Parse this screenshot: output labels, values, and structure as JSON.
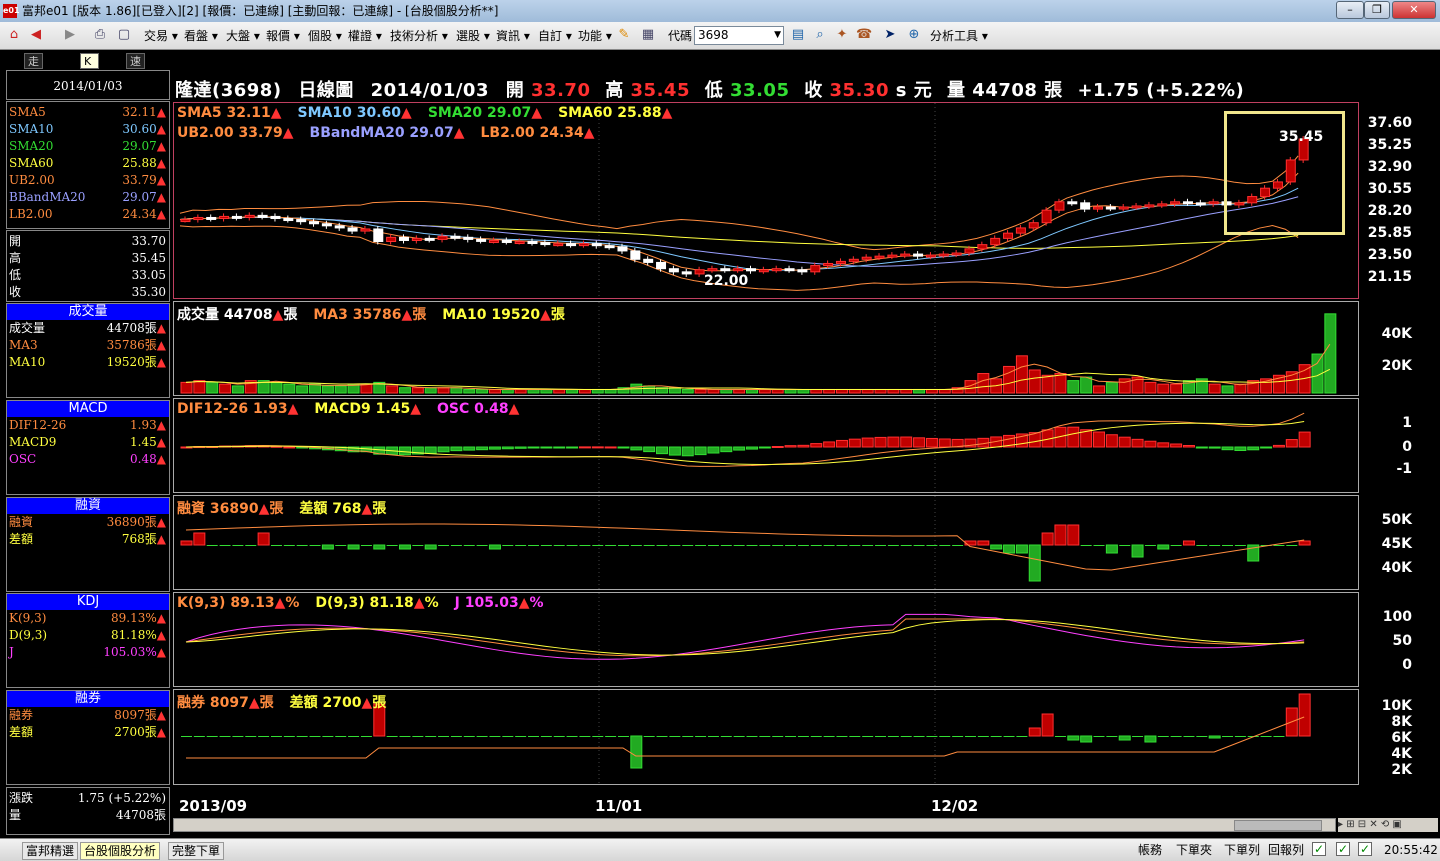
{
  "window": {
    "title": "富邦e01 [版本 1.86][已登入][2] [報價：已連線] [主動回報：已連線] - [台股個股分析**]",
    "app_icon": "e01",
    "min_btn": "–",
    "max_btn": "❐",
    "close_btn": "✕"
  },
  "toolbar": {
    "menus": [
      "交易",
      "看盤",
      "大盤",
      "報價",
      "個股",
      "權證",
      "技術分析",
      "選股",
      "資訊",
      "自訂",
      "功能"
    ],
    "code_label": "代碼",
    "code_value": "3698",
    "analysis_tools": "分析工具"
  },
  "tabs": [
    "走勢圖",
    "K線圖",
    "速覽"
  ],
  "left": {
    "date": "2014/01/03",
    "ma": [
      {
        "k": "SMA5",
        "v": "32.11",
        "c": "#ff8c40"
      },
      {
        "k": "SMA10",
        "v": "30.60",
        "c": "#7ec8ff"
      },
      {
        "k": "SMA20",
        "v": "29.07",
        "c": "#33dd33"
      },
      {
        "k": "SMA60",
        "v": "25.88",
        "c": "#ffff40"
      },
      {
        "k": "UB2.00",
        "v": "33.79",
        "c": "#ff8c40"
      },
      {
        "k": "BBandMA20",
        "v": "29.07",
        "c": "#9aa0ff"
      },
      {
        "k": "LB2.00",
        "v": "24.34",
        "c": "#ff8c40"
      }
    ],
    "ohlc": [
      {
        "k": "開",
        "v": "33.70"
      },
      {
        "k": "高",
        "v": "35.45"
      },
      {
        "k": "低",
        "v": "33.05"
      },
      {
        "k": "收",
        "v": "35.30"
      }
    ],
    "vol_head": "成交量",
    "vol": [
      {
        "k": "成交量",
        "v": "44708張",
        "c": "#ffffff"
      },
      {
        "k": "MA3",
        "v": "35786張",
        "c": "#ff8c40"
      },
      {
        "k": "MA10",
        "v": "19520張",
        "c": "#ffff40"
      }
    ],
    "macd_head": "MACD",
    "macd": [
      {
        "k": "DIF12-26",
        "v": "1.93",
        "c": "#ff8c40"
      },
      {
        "k": "MACD9",
        "v": "1.45",
        "c": "#ffff40"
      },
      {
        "k": "OSC",
        "v": "0.48",
        "c": "#ff40ff"
      }
    ],
    "margin_head": "融資",
    "margin": [
      {
        "k": "融資",
        "v": "36890張",
        "c": "#ff8c40"
      },
      {
        "k": "差額",
        "v": "768張",
        "c": "#ffff40"
      }
    ],
    "kdj_head": "KDJ",
    "kdj": [
      {
        "k": "K(9,3)",
        "v": "89.13%",
        "c": "#ff8c40"
      },
      {
        "k": "D(9,3)",
        "v": "81.18%",
        "c": "#ffff40"
      },
      {
        "k": "J",
        "v": "105.03%",
        "c": "#ff40ff"
      }
    ],
    "short_head": "融券",
    "short": [
      {
        "k": "融券",
        "v": "8097張",
        "c": "#ff8c40"
      },
      {
        "k": "差額",
        "v": "2700張",
        "c": "#ffff40"
      }
    ],
    "change": {
      "k": "漲跌",
      "v": "1.75 (+5.22%)"
    },
    "volume": {
      "k": "量",
      "v": "44708張"
    }
  },
  "header": {
    "name": "隆達(3698)",
    "type": "日線圖",
    "date": "2014/01/03",
    "open_lbl": "開",
    "open": "33.70",
    "high_lbl": "高",
    "high": "35.45",
    "low_lbl": "低",
    "low": "33.05",
    "close_lbl": "收",
    "close": "35.30",
    "unit": "s 元",
    "vol_lbl": "量",
    "vol": "44708 張",
    "chg": "+1.75 (+5.22%)"
  },
  "legends": {
    "price1": [
      {
        "t": "SMA5 32.11",
        "c": "#ff8c40"
      },
      {
        "t": "SMA10 30.60",
        "c": "#7ec8ff"
      },
      {
        "t": "SMA20 29.07",
        "c": "#33dd33"
      },
      {
        "t": "SMA60 25.88",
        "c": "#ffff40"
      }
    ],
    "price2": [
      {
        "t": "UB2.00 33.79",
        "c": "#ff8c40"
      },
      {
        "t": "BBandMA20 29.07",
        "c": "#9aa0ff"
      },
      {
        "t": "LB2.00 24.34",
        "c": "#ff8c40"
      }
    ],
    "vol": [
      {
        "t": "成交量 44708",
        "c": "#ffffff",
        "u": "張"
      },
      {
        "t": "MA3 35786",
        "c": "#ff8c40",
        "u": "張"
      },
      {
        "t": "MA10 19520",
        "c": "#ffff40",
        "u": "張"
      }
    ],
    "macd": [
      {
        "t": "DIF12-26 1.93",
        "c": "#ff8c40",
        "u": ""
      },
      {
        "t": "MACD9 1.45",
        "c": "#ffff40",
        "u": ""
      },
      {
        "t": "OSC 0.48",
        "c": "#ff40ff",
        "u": ""
      }
    ],
    "margin": [
      {
        "t": "融資 36890",
        "c": "#ff8c40",
        "u": "張"
      },
      {
        "t": "差額 768",
        "c": "#ffff40",
        "u": "張"
      }
    ],
    "kdj": [
      {
        "t": "K(9,3) 89.13",
        "c": "#ff8c40",
        "u": "%"
      },
      {
        "t": "D(9,3) 81.18",
        "c": "#ffff40",
        "u": "%"
      },
      {
        "t": "J 105.03",
        "c": "#ff40ff",
        "u": "%"
      }
    ],
    "short": [
      {
        "t": "融券 8097",
        "c": "#ff8c40",
        "u": "張"
      },
      {
        "t": "差額 2700",
        "c": "#ffff40",
        "u": "張"
      }
    ]
  },
  "axes": {
    "price": [
      "37.60",
      "35.25",
      "32.90",
      "30.55",
      "28.20",
      "25.85",
      "23.50",
      "21.15"
    ],
    "vol": [
      "40K",
      "20K"
    ],
    "macd": [
      "1",
      "0",
      "-1"
    ],
    "margin": [
      "50K",
      "45K",
      "40K"
    ],
    "kdj": [
      "100",
      "50",
      "0"
    ],
    "short": [
      "10K",
      "8K",
      "6K",
      "4K",
      "2K"
    ],
    "x": [
      "2013/09",
      "11/01",
      "12/02"
    ]
  },
  "annotations": {
    "high": "35.45",
    "low": "22.00"
  },
  "chart_data": {
    "type": "candlestick",
    "y_range": [
      21.15,
      37.6
    ],
    "close_series": [
      27.6,
      27.8,
      27.7,
      27.9,
      27.8,
      28.0,
      27.9,
      27.7,
      27.6,
      27.4,
      27.2,
      27.0,
      26.8,
      26.5,
      26.7,
      25.5,
      25.9,
      25.6,
      25.8,
      25.7,
      26.0,
      25.9,
      25.7,
      25.6,
      25.6,
      25.5,
      25.5,
      25.4,
      25.3,
      25.3,
      25.2,
      25.3,
      25.1,
      25.0,
      24.6,
      23.8,
      23.5,
      22.9,
      22.6,
      22.4,
      22.8,
      22.9,
      22.8,
      22.9,
      22.7,
      22.8,
      22.9,
      22.8,
      22.6,
      23.2,
      23.4,
      23.6,
      23.8,
      24.0,
      24.1,
      24.2,
      24.3,
      24.1,
      24.2,
      24.3,
      24.4,
      24.8,
      25.2,
      25.8,
      26.3,
      26.8,
      27.3,
      28.5,
      29.3,
      29.2,
      28.6,
      28.8,
      28.7,
      28.8,
      28.9,
      29.0,
      29.1,
      29.3,
      29.2,
      29.1,
      29.3,
      29.0,
      29.2,
      29.8,
      30.6,
      31.2,
      33.3,
      35.3
    ],
    "volume_series": [
      6,
      7,
      6,
      5,
      4,
      7,
      7,
      6,
      5,
      4,
      5,
      4,
      4,
      5,
      5,
      6,
      4,
      3,
      3,
      3,
      3,
      3,
      2,
      2,
      2,
      2,
      2,
      2,
      2,
      2,
      2,
      2,
      2,
      2,
      3,
      5,
      4,
      3,
      3,
      2,
      2,
      2,
      2,
      2,
      2,
      2,
      2,
      2,
      2,
      2,
      2,
      2,
      2,
      2,
      2,
      2,
      2,
      2,
      2,
      2,
      3,
      7,
      11,
      8,
      15,
      21,
      13,
      10,
      11,
      7,
      9,
      4,
      6,
      8,
      9,
      6,
      5,
      5,
      7,
      8,
      5,
      4,
      5,
      7,
      8,
      10,
      12,
      16,
      22,
      44.7
    ]
  },
  "statusbar": {
    "tabs": [
      "富邦精選",
      "台股個股分析",
      "完整下單"
    ],
    "buttons": [
      "帳務",
      "下單夾",
      "下單列",
      "回報列"
    ],
    "clock": "20:55:42"
  }
}
